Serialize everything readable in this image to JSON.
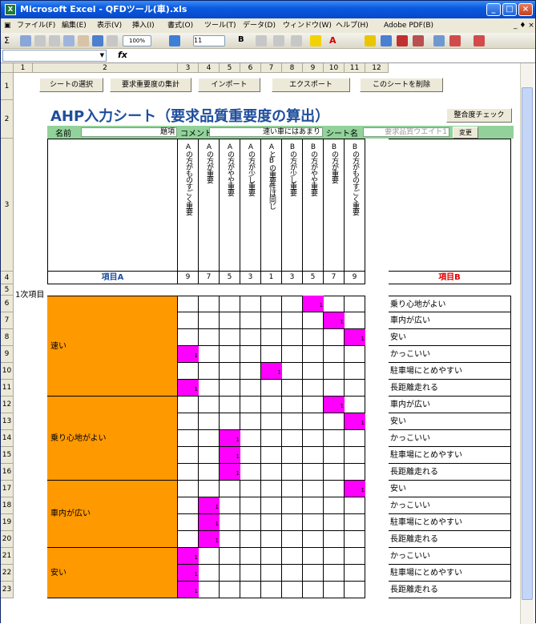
{
  "window": {
    "title": "Microsoft Excel - QFDツール(車).xls"
  },
  "menu": [
    "ファイル(F)",
    "編集(E)",
    "表示(V)",
    "挿入(I)",
    "書式(O)",
    "ツール(T)",
    "データ(D)",
    "ウィンドウ(W)",
    "ヘルプ(H)",
    "Adobe PDF(B)"
  ],
  "toolbar": {
    "zoom": "100%",
    "font_size": "11",
    "autosum": "Σ",
    "fx": "fx"
  },
  "columns": [
    "1",
    "2",
    "3",
    "4",
    "5",
    "6",
    "7",
    "8",
    "9",
    "10",
    "11",
    "12"
  ],
  "rows": [
    "1",
    "2",
    "3",
    "4",
    "5",
    "6",
    "7",
    "8",
    "9",
    "10",
    "11",
    "12",
    "13",
    "14",
    "15",
    "16",
    "17",
    "18",
    "19",
    "20",
    "21",
    "22",
    "23"
  ],
  "sheet_buttons": [
    "シートの選択",
    "要求重要度の集計",
    "インポート",
    "エクスポート",
    "このシートを削除"
  ],
  "sheet_title": "AHP入力シート（要求品質重要度の算出）",
  "check_button": "整合度チェック",
  "fields": {
    "name_label": "名前",
    "name_value": "題項",
    "comment_label": "コメント",
    "comment_value": "速い車にはあまり",
    "sheet_name_label": "シート名",
    "sheet_name_value": "要求品質ウエイト1",
    "change_button": "変更"
  },
  "scale_headers": [
    "Aの方がものすごく重要",
    "Aの方が重要",
    "Aの方がやや重要",
    "Aの方が少し重要",
    "AとBの重要性は同じ",
    "Bの方が少し重要",
    "Bの方がやや重要",
    "Bの方が重要",
    "Bの方がものすごく重要"
  ],
  "scale_values": [
    "9",
    "7",
    "5",
    "3",
    "1",
    "3",
    "5",
    "7",
    "9"
  ],
  "item_a_header": "項目A",
  "item_b_header": "項目B",
  "section_label": "1次項目",
  "groups": [
    {
      "label": "速い",
      "rows": [
        6,
        11
      ]
    },
    {
      "label": "乗り心地がよい",
      "rows": [
        12,
        16
      ]
    },
    {
      "label": "車内が広い",
      "rows": [
        17,
        20
      ]
    },
    {
      "label": "安い",
      "rows": [
        21,
        23
      ]
    }
  ],
  "comparisons": [
    {
      "row": 6,
      "b": "乗り心地がよい",
      "col": 6,
      "value": "1"
    },
    {
      "row": 7,
      "b": "車内が広い",
      "col": 7,
      "value": "1"
    },
    {
      "row": 8,
      "b": "安い",
      "col": 8,
      "value": "1"
    },
    {
      "row": 9,
      "b": "かっこいい",
      "col": 0,
      "value": "1"
    },
    {
      "row": 10,
      "b": "駐車場にとめやすい",
      "col": 4,
      "value": "1"
    },
    {
      "row": 11,
      "b": "長距離走れる",
      "col": 0,
      "value": "1"
    },
    {
      "row": 12,
      "b": "車内が広い",
      "col": 7,
      "value": "1"
    },
    {
      "row": 13,
      "b": "安い",
      "col": 8,
      "value": "1"
    },
    {
      "row": 14,
      "b": "かっこいい",
      "col": 2,
      "value": "1"
    },
    {
      "row": 15,
      "b": "駐車場にとめやすい",
      "col": 2,
      "value": "1"
    },
    {
      "row": 16,
      "b": "長距離走れる",
      "col": 2,
      "value": "1"
    },
    {
      "row": 17,
      "b": "安い",
      "col": 8,
      "value": "1"
    },
    {
      "row": 18,
      "b": "かっこいい",
      "col": 1,
      "value": "1"
    },
    {
      "row": 19,
      "b": "駐車場にとめやすい",
      "col": 1,
      "value": "1"
    },
    {
      "row": 20,
      "b": "長距離走れる",
      "col": 1,
      "value": "1"
    },
    {
      "row": 21,
      "b": "かっこいい",
      "col": 0,
      "value": "1"
    },
    {
      "row": 22,
      "b": "駐車場にとめやすい",
      "col": 0,
      "value": "1"
    },
    {
      "row": 23,
      "b": "長距離走れる",
      "col": 0,
      "value": "1"
    }
  ],
  "colors": {
    "orange": "#ff9900",
    "magenta": "#ff00ff",
    "green": "#92d29a",
    "title_blue": "#1f4e9c",
    "item_b_red": "#e00000"
  }
}
